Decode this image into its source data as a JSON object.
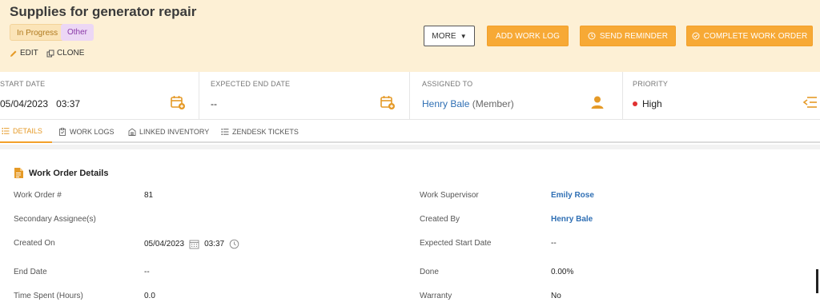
{
  "header": {
    "title": "Supplies for generator repair",
    "status_badge": "In Progress",
    "category_badge": "Other",
    "edit_label": "EDIT",
    "clone_label": "CLONE",
    "buttons": {
      "more": "MORE",
      "add_work_log": "ADD WORK LOG",
      "send_reminder": "SEND REMINDER",
      "complete_work_order": "COMPLETE WORK ORDER"
    }
  },
  "info": {
    "start_date": {
      "label": "START DATE",
      "date": "05/04/2023",
      "time": "03:37"
    },
    "expected_end_date": {
      "label": "EXPECTED END DATE",
      "value": "--"
    },
    "assigned_to": {
      "label": "ASSIGNED TO",
      "name": "Henry Bale",
      "role": "(Member)"
    },
    "priority": {
      "label": "PRIORITY",
      "value": "High",
      "color": "#e03131"
    }
  },
  "tabs": [
    {
      "label": "DETAILS",
      "icon": "list-icon",
      "active": true
    },
    {
      "label": "WORK LOGS",
      "icon": "clipboard-icon",
      "active": false
    },
    {
      "label": "LINKED INVENTORY",
      "icon": "inventory-icon",
      "active": false
    },
    {
      "label": "ZENDESK TICKETS",
      "icon": "list-icon",
      "active": false
    }
  ],
  "details": {
    "section_title": "Work Order Details",
    "left": [
      {
        "label": "Work Order #",
        "value": "81"
      },
      {
        "label": "Secondary Assignee(s)",
        "value": ""
      },
      {
        "label": "Created On",
        "date": "05/04/2023",
        "time": "03:37"
      },
      {
        "label": "End Date",
        "value": "--"
      },
      {
        "label": "Time Spent (Hours)",
        "value": "0.0"
      }
    ],
    "right": [
      {
        "label": "Work Supervisor",
        "value": "Emily Rose"
      },
      {
        "label": "Created By",
        "value": "Henry Bale"
      },
      {
        "label": "Expected Start Date",
        "value": "--"
      },
      {
        "label": "Done",
        "value": "0.00%"
      },
      {
        "label": "Warranty",
        "value": "No"
      }
    ]
  },
  "colors": {
    "accent": "#f7a935",
    "header_bg": "#fdf0d5",
    "link": "#2f6fb4"
  }
}
